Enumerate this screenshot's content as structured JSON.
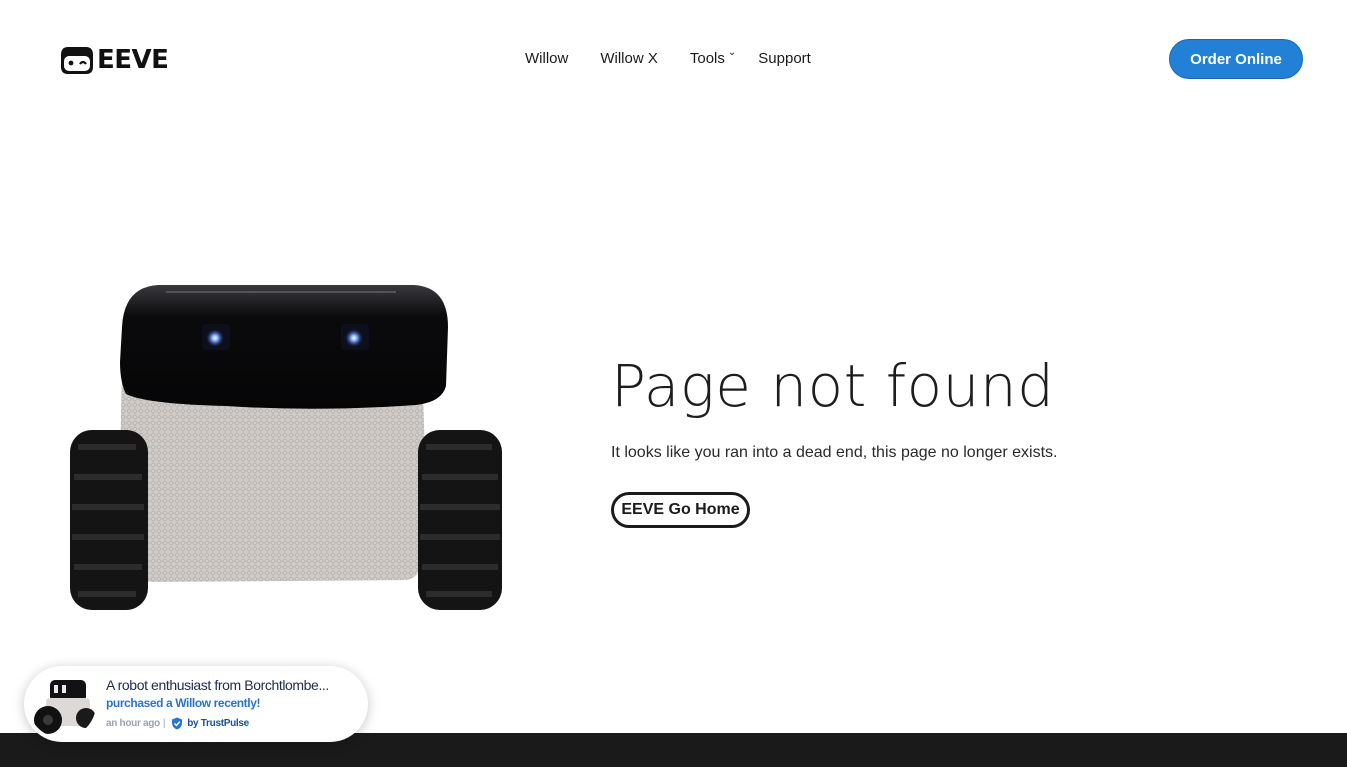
{
  "header": {
    "brand": "EEVE",
    "nav": [
      {
        "label": "Willow"
      },
      {
        "label": "Willow X"
      },
      {
        "label": "Tools"
      },
      {
        "label": "Support"
      }
    ],
    "order_label": "Order Online"
  },
  "main": {
    "title": "Page not found",
    "message": "It looks like you ran into a dead end, this page no longer exists.",
    "home_button": "EEVE Go Home"
  },
  "toast": {
    "headline": "A robot enthusiast from Borchtlombe...",
    "action": "purchased a Willow recently!",
    "time": "an hour ago",
    "separator": "|",
    "verified_by": "by TrustPulse"
  },
  "colors": {
    "accent": "#2280d6",
    "footer": "#1a1a1a",
    "toast_link": "#2a73d2"
  },
  "icons": {
    "logo": "robot-face-icon",
    "caret": "chevron-down-icon",
    "verified": "check-shield-icon"
  }
}
